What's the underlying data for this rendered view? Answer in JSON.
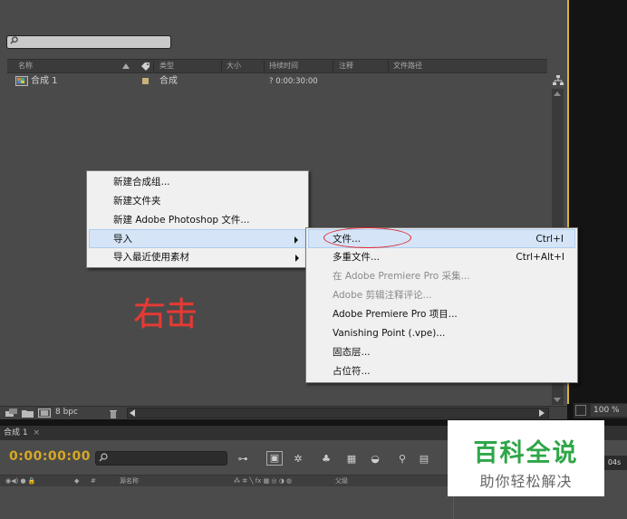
{
  "project_panel": {
    "search": {
      "value": "",
      "placeholder": ""
    },
    "columns": [
      "名称",
      "类型",
      "大小",
      "持续时间",
      "注释",
      "文件路径"
    ],
    "rows": [
      {
        "name": "合成 1",
        "type": "合成",
        "duration": "? 0:00:30:00"
      }
    ],
    "footer": {
      "bpc": "8 bpc"
    }
  },
  "context_menu": {
    "items": [
      {
        "label": "新建合成组..."
      },
      {
        "label": "新建文件夹"
      },
      {
        "label": "新建 Adobe Photoshop 文件..."
      },
      {
        "label": "导入"
      },
      {
        "label": "导入最近使用素材"
      }
    ]
  },
  "submenu": {
    "items": [
      {
        "label": "文件...",
        "shortcut": "Ctrl+I"
      },
      {
        "label": "多重文件...",
        "shortcut": "Ctrl+Alt+I"
      },
      {
        "label": "在 Adobe Premiere Pro 采集..."
      },
      {
        "label": "Adobe 剪辑注释评论..."
      },
      {
        "label": "Adobe Premiere Pro 项目..."
      },
      {
        "label": "Vanishing Point (.vpe)..."
      },
      {
        "label": "固态层..."
      },
      {
        "label": "占位符..."
      }
    ]
  },
  "annotation": "右击",
  "viewer": {
    "zoom": "100 %"
  },
  "timeline": {
    "tab_label": "合成 1",
    "timecode": "0:00:00:00",
    "search": {
      "value": "",
      "placeholder": ""
    },
    "col_hash": "#",
    "col_source": "源名称",
    "col_parent": "父级",
    "right_label": "04s"
  },
  "watermark": {
    "title": "百科全说",
    "subtitle": "助你轻松解决"
  },
  "colors": {
    "accent_timecode": "#d6a826",
    "annotation_red": "#e53a34",
    "watermark_green": "#2fa648",
    "highlight": "#d5e5f7"
  }
}
